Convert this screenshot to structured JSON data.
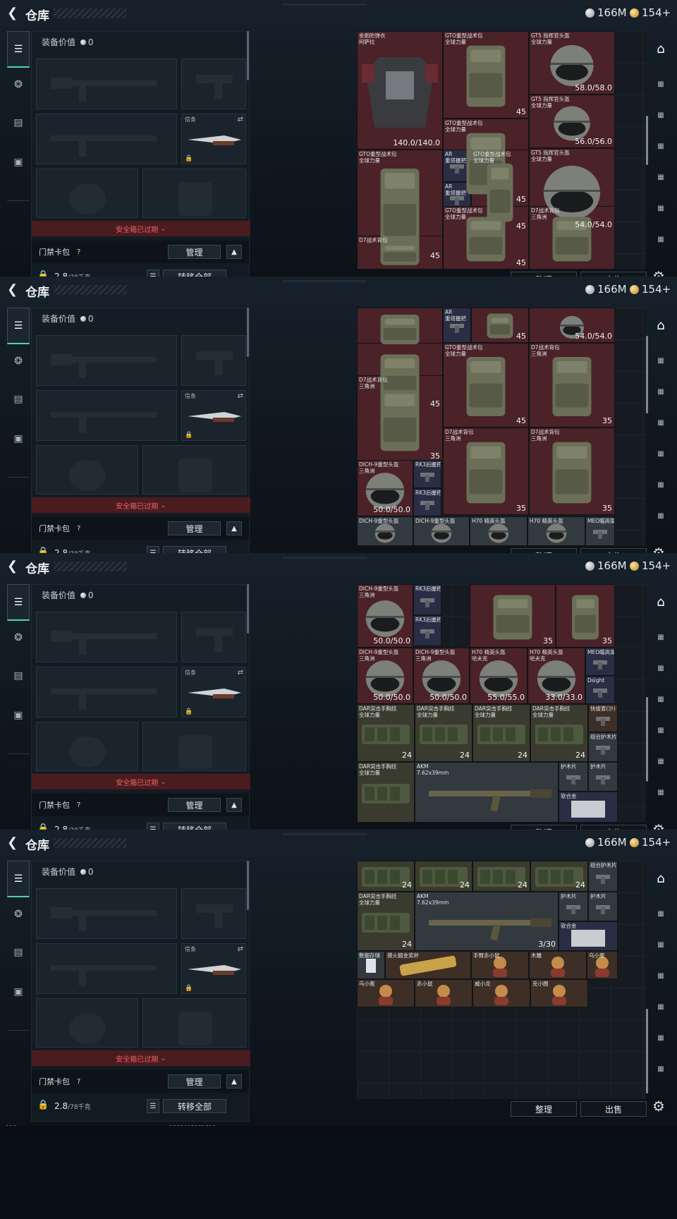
{
  "header": {
    "title": "仓库",
    "silver": "166M",
    "gold": "154+"
  },
  "left": {
    "equip_value_label": "装备价值",
    "equip_value": "0",
    "knife_label": "信条",
    "safe_box": "安全箱已过期",
    "key_bag": "门禁卡包",
    "question": "?",
    "manage": "管理",
    "weight": "2.8",
    "weight_max": "/78千克",
    "transfer_all": "转移全部"
  },
  "footer": {
    "ping": [
      "73ms",
      "110ms",
      "110ms",
      "110ms"
    ],
    "uid": "1202608181700"
  },
  "buttons": {
    "sort": "整理",
    "sell": "出售"
  },
  "screens": [
    {
      "cells": [
        {
          "name": "金刚防弹衣\n阿萨拉",
          "val": "140.0/140.0",
          "type": "armor"
        },
        {
          "name": "GTO重型战术包\n全球力量",
          "cnt": "45",
          "type": "pack"
        },
        {
          "name": "GT5 指挥官头盔\n全球力量",
          "val": "58.0/58.0",
          "type": "helmet"
        },
        {
          "name": "GTO重型战术包\n全球力量",
          "cnt": "45",
          "type": "pack"
        },
        {
          "name": "GT5 指挥官头盔\n全球力量",
          "val": "56.0/56.0",
          "type": "helmet"
        },
        {
          "name": "GTO重型战术包\n全球力量",
          "cnt": "45",
          "type": "pack"
        },
        {
          "name": "AR\n重塔握把",
          "type": "grip"
        },
        {
          "name": "AR\n重塔握把",
          "type": "grip"
        },
        {
          "name": "GTO重型战术包\n全球力量",
          "cnt": "45",
          "type": "pack"
        },
        {
          "name": "GT5 指挥官头盔\n全球力量",
          "val": "54.0/54.0",
          "type": "helmet"
        },
        {
          "name": "GTO重型战术包\n全球力量",
          "cnt": "45",
          "type": "pack"
        },
        {
          "name": "D7战术背包\n三角洲",
          "type": "pack"
        },
        {
          "name": "D7战术背包",
          "type": "pack"
        }
      ]
    },
    {
      "cells": [
        {
          "name": "",
          "type": "pack"
        },
        {
          "name": "AR\n重塔握把",
          "type": "grip"
        },
        {
          "name": "",
          "cnt": "45",
          "type": "pack"
        },
        {
          "name": "",
          "val": "54.0/54.0",
          "type": "helmet"
        },
        {
          "name": "",
          "cnt": "45",
          "type": "pack"
        },
        {
          "name": "GTO重型战术包\n全球力量",
          "cnt": "45",
          "type": "pack"
        },
        {
          "name": "D7战术背包\n三角洲",
          "cnt": "35",
          "type": "pack"
        },
        {
          "name": "D7战术背包\n三角洲",
          "cnt": "35",
          "type": "pack"
        },
        {
          "name": "D7战术背包\n三角洲",
          "cnt": "35",
          "type": "pack"
        },
        {
          "name": "D7战术背包\n三角洲",
          "cnt": "35",
          "type": "pack"
        },
        {
          "name": "DICH-9重型头盔\n三角洲",
          "val": "50.0/50.0",
          "type": "helmet"
        },
        {
          "name": "RK3后握把",
          "type": "grip"
        },
        {
          "name": "RK3后握把",
          "type": "grip"
        },
        {
          "name": "DICH-9重型头盔",
          "type": "helmet"
        },
        {
          "name": "DICH-9重型头盔",
          "type": "helmet"
        },
        {
          "name": "H70 精英头盔",
          "type": "helmet"
        },
        {
          "name": "H70 精英头盔",
          "type": "helmet"
        },
        {
          "name": "MEO瞄高架",
          "type": "grip"
        }
      ]
    },
    {
      "cells": [
        {
          "name": "DICH-9重型头盔\n三角洲",
          "val": "50.0/50.0",
          "type": "helmet"
        },
        {
          "name": "RK3后握把",
          "type": "grip"
        },
        {
          "name": "RK3后握把",
          "type": "grip"
        },
        {
          "name": "",
          "cnt": "35",
          "type": "pack"
        },
        {
          "name": "",
          "cnt": "35",
          "type": "pack"
        },
        {
          "name": "DICH-9重型头盔\n三角洲",
          "val": "50.0/50.0",
          "type": "helmet"
        },
        {
          "name": "DICH-9重型头盔\n三角洲",
          "val": "50.0/50.0",
          "type": "helmet"
        },
        {
          "name": "H70 精英头盔\n哈夫克",
          "val": "55.0/55.0",
          "type": "helmet"
        },
        {
          "name": "H70 精英头盔\n哈夫克",
          "val": "33.0/33.0",
          "type": "helmet"
        },
        {
          "name": "MEO瞄高架",
          "type": "grip"
        },
        {
          "name": "Dsight",
          "type": "grip"
        },
        {
          "name": "DAR突击手胸挂\n全球力量",
          "cnt": "24",
          "type": "rig"
        },
        {
          "name": "DAR突击手胸挂\n全球力量",
          "cnt": "24",
          "type": "rig"
        },
        {
          "name": "DAR突击手胸挂\n全球力量",
          "cnt": "24",
          "type": "rig"
        },
        {
          "name": "DAR突击手胸挂\n全球力量",
          "cnt": "24",
          "type": "rig"
        },
        {
          "name": "快拔套(沙)",
          "type": "grip"
        },
        {
          "name": "组合护木片",
          "type": "grip"
        },
        {
          "name": "DAR突击手胸挂\n全球力量",
          "type": "rig"
        },
        {
          "name": "AKM\n7.62x39mm",
          "type": "rifle"
        },
        {
          "name": "护木片",
          "type": "grip"
        },
        {
          "name": "护木片",
          "type": "grip"
        },
        {
          "name": "软合金",
          "type": "metal"
        }
      ]
    },
    {
      "cells": [
        {
          "name": "",
          "cnt": "24",
          "type": "rig"
        },
        {
          "name": "",
          "cnt": "24",
          "type": "rig"
        },
        {
          "name": "",
          "cnt": "24",
          "type": "rig"
        },
        {
          "name": "",
          "cnt": "24",
          "type": "rig"
        },
        {
          "name": "组合护木片",
          "type": "grip"
        },
        {
          "name": "DAR突击手胸挂\n全球力量",
          "cnt": "24",
          "type": "rig"
        },
        {
          "name": "AKM\n7.62x39mm",
          "cnt": "3/30",
          "type": "rifle"
        },
        {
          "name": "护木片",
          "type": "grip"
        },
        {
          "name": "护木片",
          "type": "grip"
        },
        {
          "name": "软合金",
          "type": "metal"
        },
        {
          "name": "数据存储",
          "type": "card"
        },
        {
          "name": "摸火掘金奖杯",
          "type": "trophy"
        },
        {
          "name": "手臂赤小鼠",
          "type": "figure"
        },
        {
          "name": "木雕",
          "type": "figure"
        },
        {
          "name": "乌小蛋",
          "type": "figure"
        },
        {
          "name": "乌小蛋",
          "type": "figure"
        },
        {
          "name": "赤小鼠",
          "type": "figure"
        },
        {
          "name": "威小龙",
          "type": "figure"
        },
        {
          "name": "克小圈",
          "type": "figure"
        }
      ]
    }
  ]
}
